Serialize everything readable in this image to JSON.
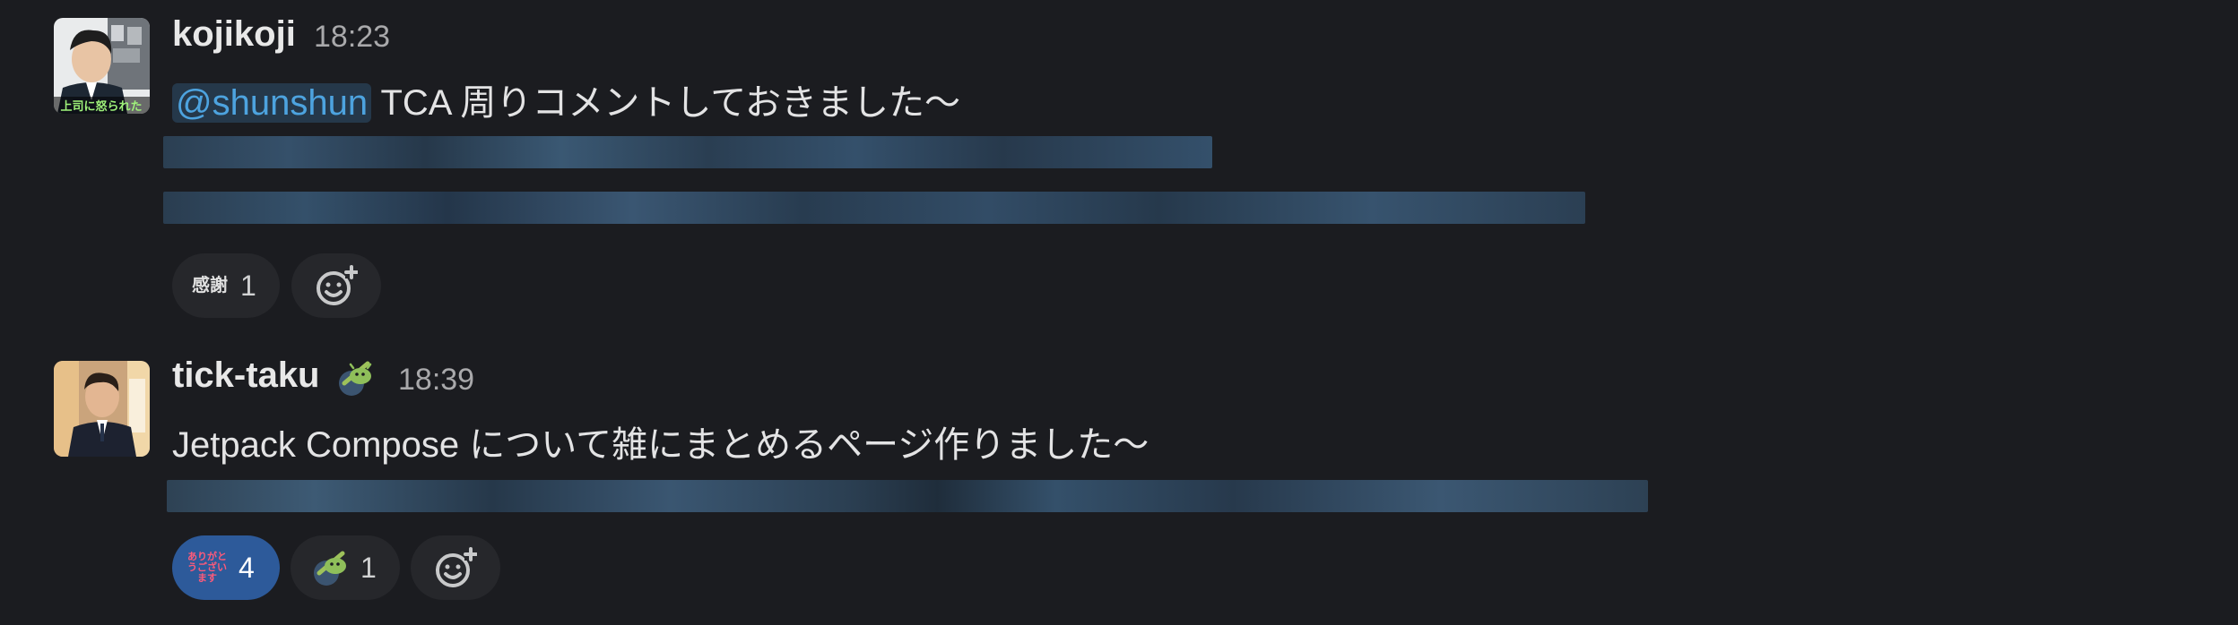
{
  "messages": [
    {
      "username": "kojikoji",
      "time": "18:23",
      "mention": "@shunshun",
      "text": " TCA 周りコメントしておきました〜",
      "avatar_caption": "上司に怒られた",
      "reactions": [
        {
          "emoji_name": "kansha-emoji",
          "emoji_text": "感謝",
          "count": "1"
        }
      ]
    },
    {
      "username": "tick-taku",
      "time": "18:39",
      "status_emoji": "android-emoji",
      "text": "Jetpack Compose について雑にまとめるページ作りました〜",
      "reactions": [
        {
          "emoji_name": "arigatou-emoji",
          "emoji_text": "ありがとうございます",
          "count": "4",
          "active": true
        },
        {
          "emoji_name": "android-emoji",
          "count": "1"
        }
      ]
    }
  ],
  "colors": {
    "background": "#1b1c20",
    "mention_text": "#4da3df",
    "mention_bg": "#25384a",
    "reaction_bg": "#26272b",
    "reaction_active_bg": "#2d5a9a"
  }
}
